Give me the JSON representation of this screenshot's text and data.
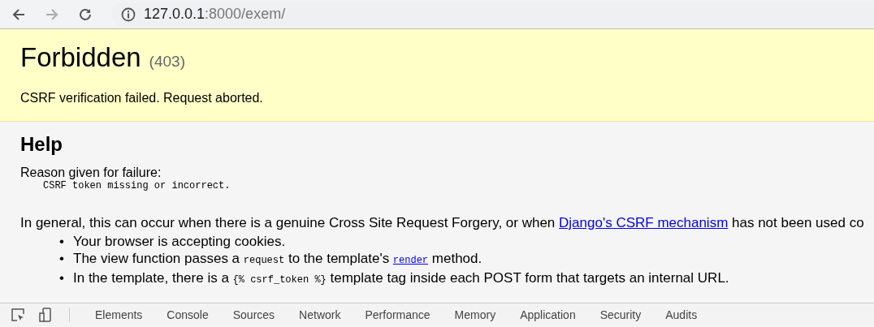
{
  "browser": {
    "url_host": "127.0.0.1",
    "url_rest": ":8000/exem/"
  },
  "summary": {
    "title": "Forbidden",
    "code": "(403)",
    "message": "CSRF verification failed. Request aborted."
  },
  "help": {
    "heading": "Help",
    "reason_label": "Reason given for failure:",
    "reason": "CSRF token missing or incorrect.",
    "paragraph": [
      {
        "kind": "text",
        "text": "In general, this can occur when there is a genuine Cross Site Request Forgery, or when "
      },
      {
        "kind": "link",
        "text": "Django's CSRF mechanism"
      },
      {
        "kind": "text",
        "text": " has not been used co"
      }
    ],
    "bullet_marker": "•",
    "bullets": [
      [
        {
          "kind": "text",
          "text": "Your browser is accepting cookies."
        }
      ],
      [
        {
          "kind": "text",
          "text": "The view function passes a "
        },
        {
          "kind": "code",
          "text": "request"
        },
        {
          "kind": "text",
          "text": " to the template's "
        },
        {
          "kind": "codelink",
          "text": "render"
        },
        {
          "kind": "text",
          "text": " method."
        }
      ],
      [
        {
          "kind": "text",
          "text": "In the template, there is a "
        },
        {
          "kind": "code",
          "text": "{% csrf_token %}"
        },
        {
          "kind": "text",
          "text": " template tag inside each POST form that targets an internal URL."
        }
      ]
    ]
  },
  "devtools": {
    "tabs": [
      {
        "label": "Elements",
        "selected": false
      },
      {
        "label": "Console",
        "selected": false
      },
      {
        "label": "Sources",
        "selected": false
      },
      {
        "label": "Network",
        "selected": false
      },
      {
        "label": "Performance",
        "selected": false
      },
      {
        "label": "Memory",
        "selected": false
      },
      {
        "label": "Application",
        "selected": false
      },
      {
        "label": "Security",
        "selected": false
      },
      {
        "label": "Audits",
        "selected": false
      }
    ]
  }
}
